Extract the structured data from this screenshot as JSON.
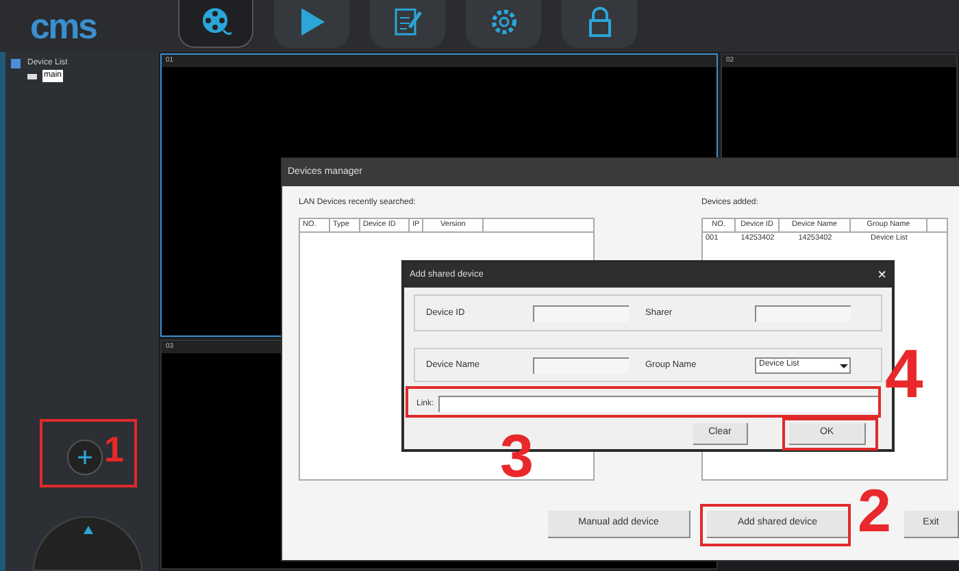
{
  "app": {
    "logo": "cms"
  },
  "toolbar": [
    {
      "kind": "film"
    },
    {
      "kind": "play"
    },
    {
      "kind": "edit"
    },
    {
      "kind": "gear"
    },
    {
      "kind": "lock"
    }
  ],
  "sidebar": {
    "tree": [
      {
        "label": "Device List",
        "expanded": true,
        "children": [
          {
            "label": "main",
            "selected": true
          }
        ]
      }
    ]
  },
  "video_panels": [
    {
      "label": "01",
      "kind": "wide"
    },
    {
      "label": "02",
      "kind": "side"
    },
    {
      "label": "03",
      "kind": "bottom"
    }
  ],
  "devices_manager": {
    "title": "Devices manager",
    "lan_label": "LAN Devices recently searched:",
    "lan_columns": [
      "NO.",
      "Type",
      "Device ID",
      "IP",
      "Version"
    ],
    "added_label": "Devices added:",
    "added_columns": [
      "NO.",
      "Device ID",
      "Device Name",
      "Group Name"
    ],
    "added_rows": [
      [
        "001",
        "14253402",
        "14253402",
        "Device List"
      ]
    ],
    "buttons": [
      "Manual add device",
      "Add shared device",
      "Exit"
    ]
  },
  "add_shared_dialog": {
    "title": "Add shared device",
    "close": "×",
    "device_id_label": "Device ID",
    "sharer_label": "Sharer",
    "device_name_label": "Device Name",
    "group_name_label": "Group Name",
    "group_name_value": "Device List",
    "link_label": "Link:",
    "buttons": [
      "Clear",
      "OK"
    ]
  },
  "annotations": [
    {
      "number": "1"
    },
    {
      "number": "2"
    },
    {
      "number": "3"
    },
    {
      "number": "4"
    }
  ]
}
